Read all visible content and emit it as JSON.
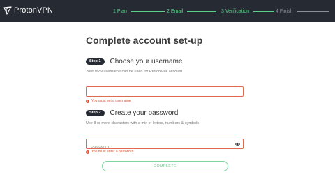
{
  "app": {
    "name": "ProtonVPN"
  },
  "steps": [
    {
      "label": "1  Plan",
      "state": "done"
    },
    {
      "label": "2  Email",
      "state": "done"
    },
    {
      "label": "3  Verification",
      "state": "done"
    },
    {
      "label": "4  Finish",
      "state": "todo"
    }
  ],
  "page": {
    "title": "Complete account set-up"
  },
  "username_section": {
    "step_badge": "Step 1",
    "heading": "Choose your username",
    "helper": "Your VPN username can be used for ProtonMail account",
    "value": "",
    "error": "You must set a username"
  },
  "password_section": {
    "step_badge": "Step 2",
    "heading": "Create your password",
    "helper": "Use 8 or more characters with a mix of letters, numbers & symbols",
    "placeholder": "Password",
    "error": "You must enter a password"
  },
  "actions": {
    "complete_label": "COMPLETE"
  },
  "colors": {
    "accent": "#5ccf8b",
    "error": "#d9543a",
    "topbar": "#262a33"
  }
}
